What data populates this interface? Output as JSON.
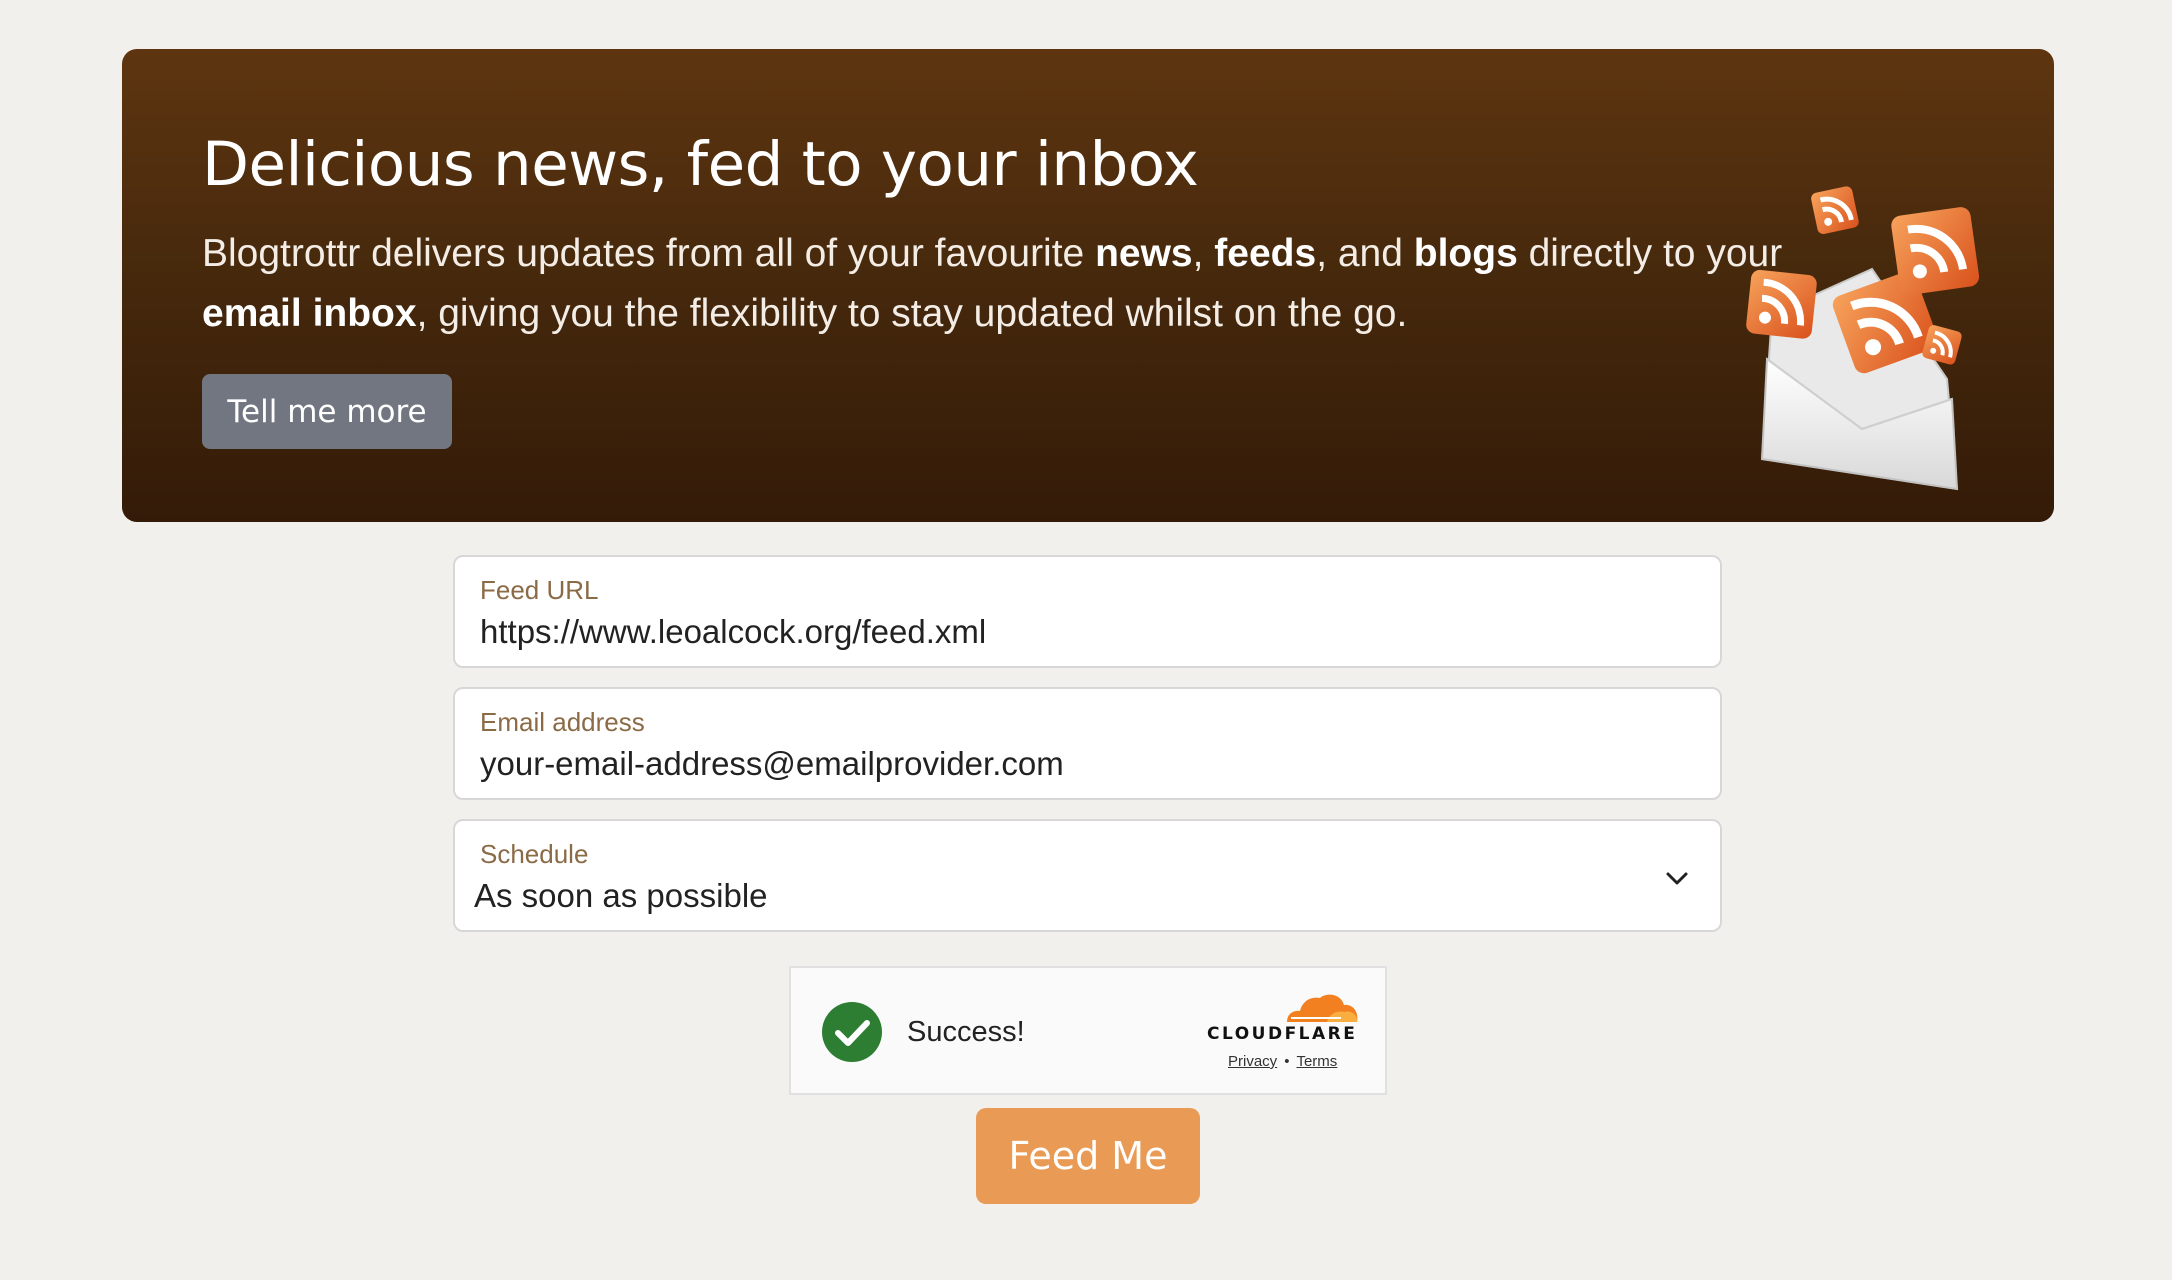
{
  "hero": {
    "title": "Delicious news, fed to your inbox",
    "desc_parts": [
      "Blogtrottr delivers updates from all of your favourite ",
      "news",
      ", ",
      "feeds",
      ", and ",
      "blogs",
      " directly to your ",
      "email inbox",
      ", giving you the flexibility to stay updated whilst on the go."
    ],
    "cta_label": "Tell me more",
    "art_icon": "envelope-rss-illustration"
  },
  "form": {
    "feed_url": {
      "label": "Feed URL",
      "value": "https://www.leoalcock.org/feed.xml"
    },
    "email": {
      "label": "Email address",
      "value": "your-email-address@emailprovider.com"
    },
    "schedule": {
      "label": "Schedule",
      "value": "As soon as possible",
      "icon": "chevron-down-icon"
    },
    "submit_label": "Feed Me"
  },
  "turnstile": {
    "status": "Success!",
    "brand": "CLOUDFLARE",
    "privacy": "Privacy",
    "separator": "•",
    "terms": "Terms",
    "status_color": "#2d7d32",
    "brand_color": "#f38020"
  },
  "colors": {
    "accent": "#e99a55",
    "hero_top": "#5e3510",
    "hero_bottom": "#341b08",
    "label": "#8b6a46",
    "background": "#f2f0ec"
  }
}
